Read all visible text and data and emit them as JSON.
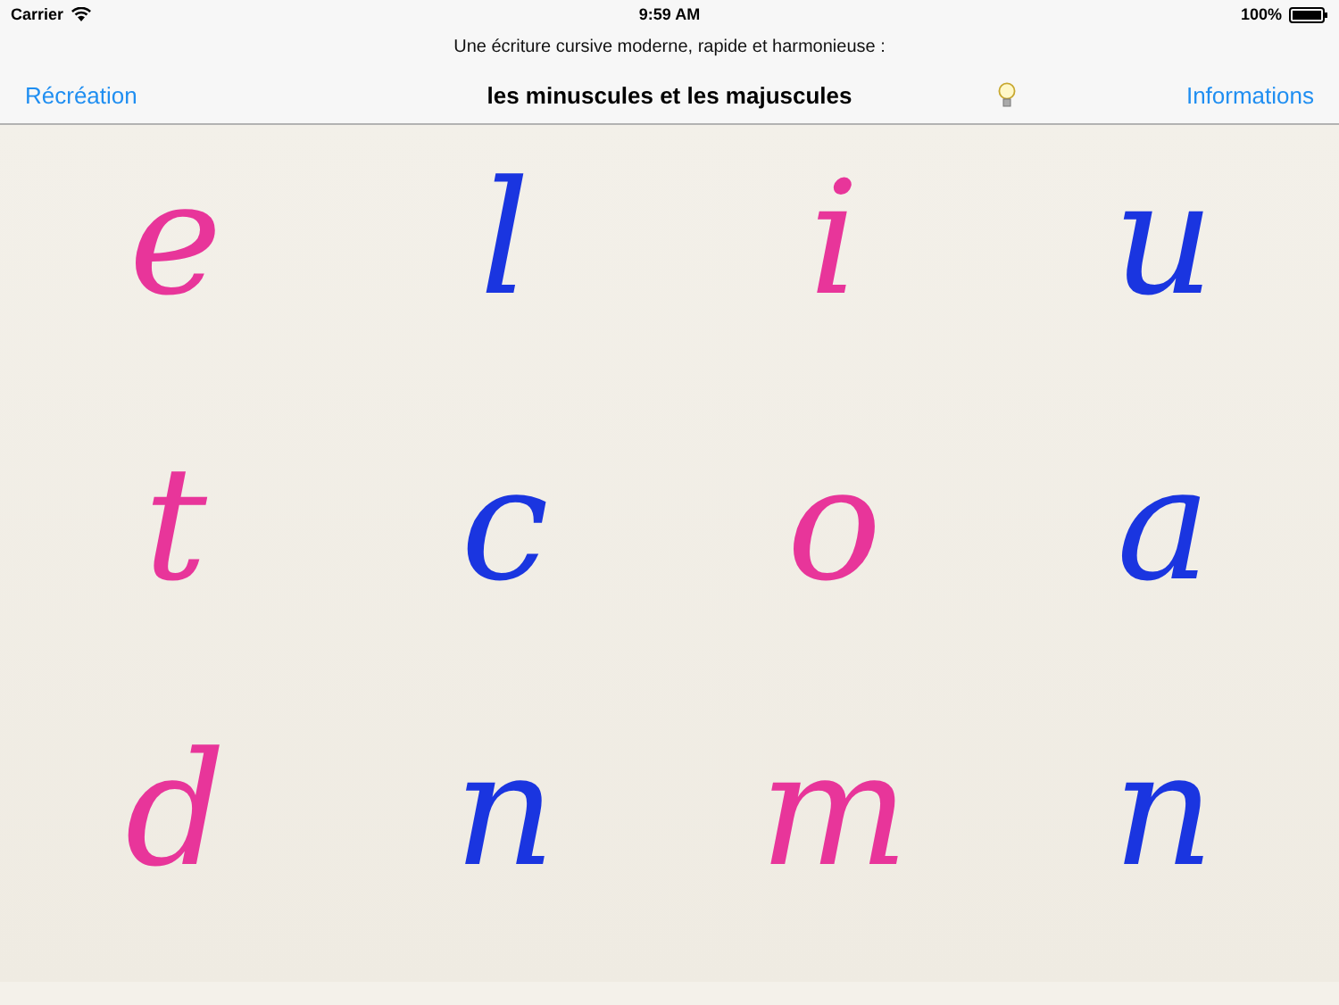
{
  "status_bar": {
    "carrier": "Carrier",
    "time": "9:59 AM",
    "battery": "100%"
  },
  "subtitle": "Une écriture cursive moderne, rapide et harmonieuse :",
  "nav_bar": {
    "left": "Récréation",
    "title": "les minuscules et les majuscules",
    "right": "Informations"
  },
  "letters": [
    {
      "text": "e",
      "color": "#e8359a"
    },
    {
      "text": "l",
      "color": "#1a35e0"
    },
    {
      "text": "i",
      "color": "#e8359a"
    },
    {
      "text": "u",
      "color": "#1a35e0"
    },
    {
      "text": "t",
      "color": "#e8359a"
    },
    {
      "text": "c",
      "color": "#1a35e0"
    },
    {
      "text": "o",
      "color": "#e8359a"
    },
    {
      "text": "a",
      "color": "#1a35e0"
    },
    {
      "text": "d",
      "color": "#e8359a"
    },
    {
      "text": "n",
      "color": "#1a35e0"
    },
    {
      "text": "m",
      "color": "#e8359a"
    },
    {
      "text": "n",
      "color": "#1a35e0"
    }
  ]
}
